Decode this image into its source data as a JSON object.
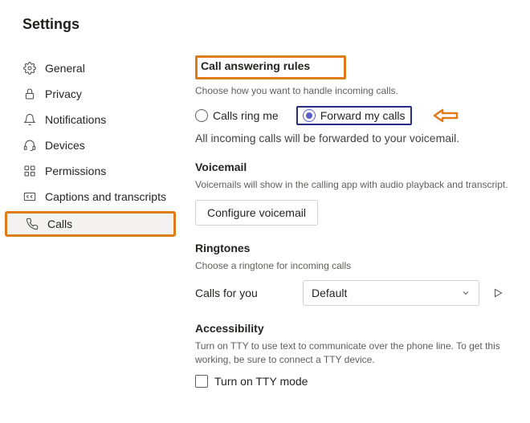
{
  "title": "Settings",
  "sidebar": {
    "items": [
      {
        "label": "General"
      },
      {
        "label": "Privacy"
      },
      {
        "label": "Notifications"
      },
      {
        "label": "Devices"
      },
      {
        "label": "Permissions"
      },
      {
        "label": "Captions and transcripts"
      },
      {
        "label": "Calls"
      }
    ],
    "active_index": 6
  },
  "call_rules": {
    "heading": "Call answering rules",
    "desc": "Choose how you want to handle incoming calls.",
    "options": [
      {
        "label": "Calls ring me",
        "selected": false
      },
      {
        "label": "Forward my calls",
        "selected": true
      }
    ],
    "status": "All incoming calls will be forwarded to your voicemail."
  },
  "voicemail": {
    "heading": "Voicemail",
    "desc": "Voicemails will show in the calling app with audio playback and transcript.",
    "button": "Configure voicemail"
  },
  "ringtones": {
    "heading": "Ringtones",
    "desc": "Choose a ringtone for incoming calls",
    "row_label": "Calls for you",
    "selected": "Default"
  },
  "accessibility": {
    "heading": "Accessibility",
    "desc": "Turn on TTY to use text to communicate over the phone line. To get this working, be sure to connect a TTY device.",
    "checkbox_label": "Turn on TTY mode",
    "checked": false
  }
}
